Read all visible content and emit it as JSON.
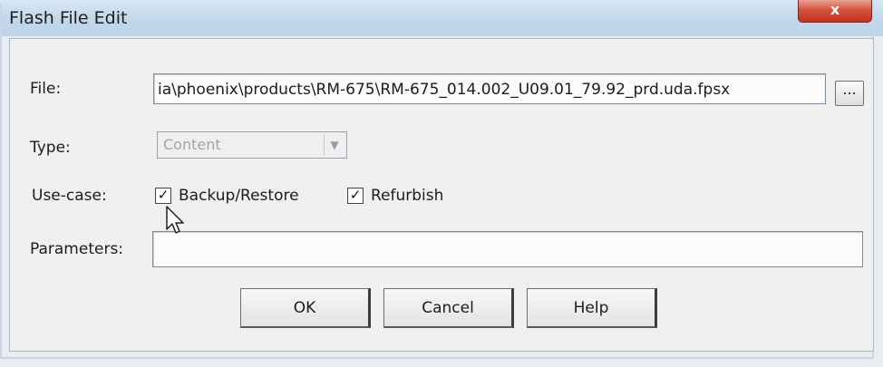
{
  "window": {
    "title": "Flash File Edit",
    "close_glyph": "x"
  },
  "file": {
    "label": "File:",
    "value": "ia\\phoenix\\products\\RM-675\\RM-675_014.002_U09.01_79.92_prd.uda.fpsx",
    "browse_label": "..."
  },
  "type": {
    "label": "Type:",
    "value": "Content",
    "disabled": true
  },
  "use_case": {
    "label": "Use-case:",
    "options": [
      {
        "label": "Backup/Restore",
        "checked": true
      },
      {
        "label": "Refurbish",
        "checked": true
      }
    ]
  },
  "parameters": {
    "label": "Parameters:",
    "value": ""
  },
  "buttons": {
    "ok": "OK",
    "cancel": "Cancel",
    "help": "Help"
  },
  "icons": {
    "checkmark": "check-icon",
    "dropdown": "chevron-down-icon",
    "cursor": "mouse-cursor-icon"
  }
}
